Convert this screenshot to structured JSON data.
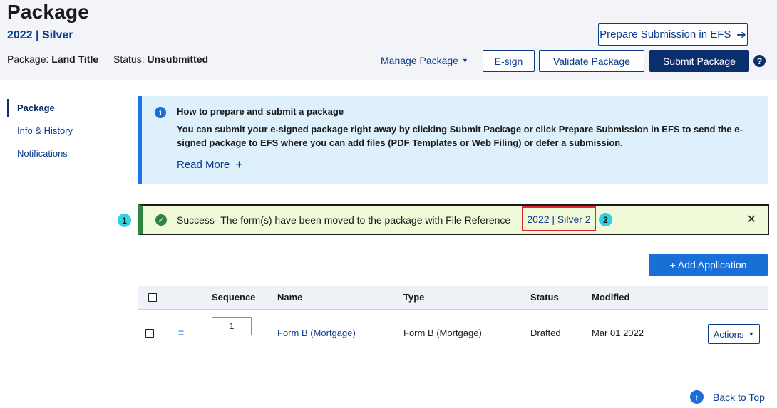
{
  "header": {
    "title": "Package",
    "subtitle": "2022 | Silver",
    "package_label": "Package:",
    "package_value": "Land Title",
    "status_label": "Status:",
    "status_value": "Unsubmitted",
    "prepare_label": "Prepare Submission in EFS",
    "manage_label": "Manage Package",
    "esign_label": "E-sign",
    "validate_label": "Validate Package",
    "submit_label": "Submit Package",
    "help_glyph": "?"
  },
  "sidebar": {
    "items": [
      {
        "label": "Package",
        "active": true
      },
      {
        "label": "Info & History",
        "active": false
      },
      {
        "label": "Notifications",
        "active": false
      }
    ]
  },
  "info": {
    "title": "How to prepare and submit a package",
    "body": "You can submit your e-signed package right away by clicking Submit Package or click Prepare Submission in EFS to send the e-signed package to EFS where you can add files (PDF Templates or Web Filing) or defer a submission.",
    "read_more": "Read More"
  },
  "success": {
    "marker_1": "1",
    "marker_2": "2",
    "text": "Success- The form(s) have been moved to the package with File Reference",
    "file_reference": "2022 | Silver 2"
  },
  "add_application_label": "+ Add Application",
  "table": {
    "headers": {
      "sequence": "Sequence",
      "name": "Name",
      "type": "Type",
      "status": "Status",
      "modified": "Modified"
    },
    "rows": [
      {
        "sequence": "1",
        "name": "Form B (Mortgage)",
        "type": "Form B (Mortgage)",
        "status": "Drafted",
        "modified": "Mar 01 2022",
        "actions_label": "Actions"
      }
    ]
  },
  "back_to_top": "Back to Top",
  "colors": {
    "brand_navy": "#0b2e6f",
    "link_blue": "#0b3b8c",
    "info_bg": "#def0fb",
    "success_bg": "#f0f9d8",
    "success_green": "#2e8540",
    "highlight_red": "#e0262a",
    "marker_cyan": "#2ed4e6"
  }
}
